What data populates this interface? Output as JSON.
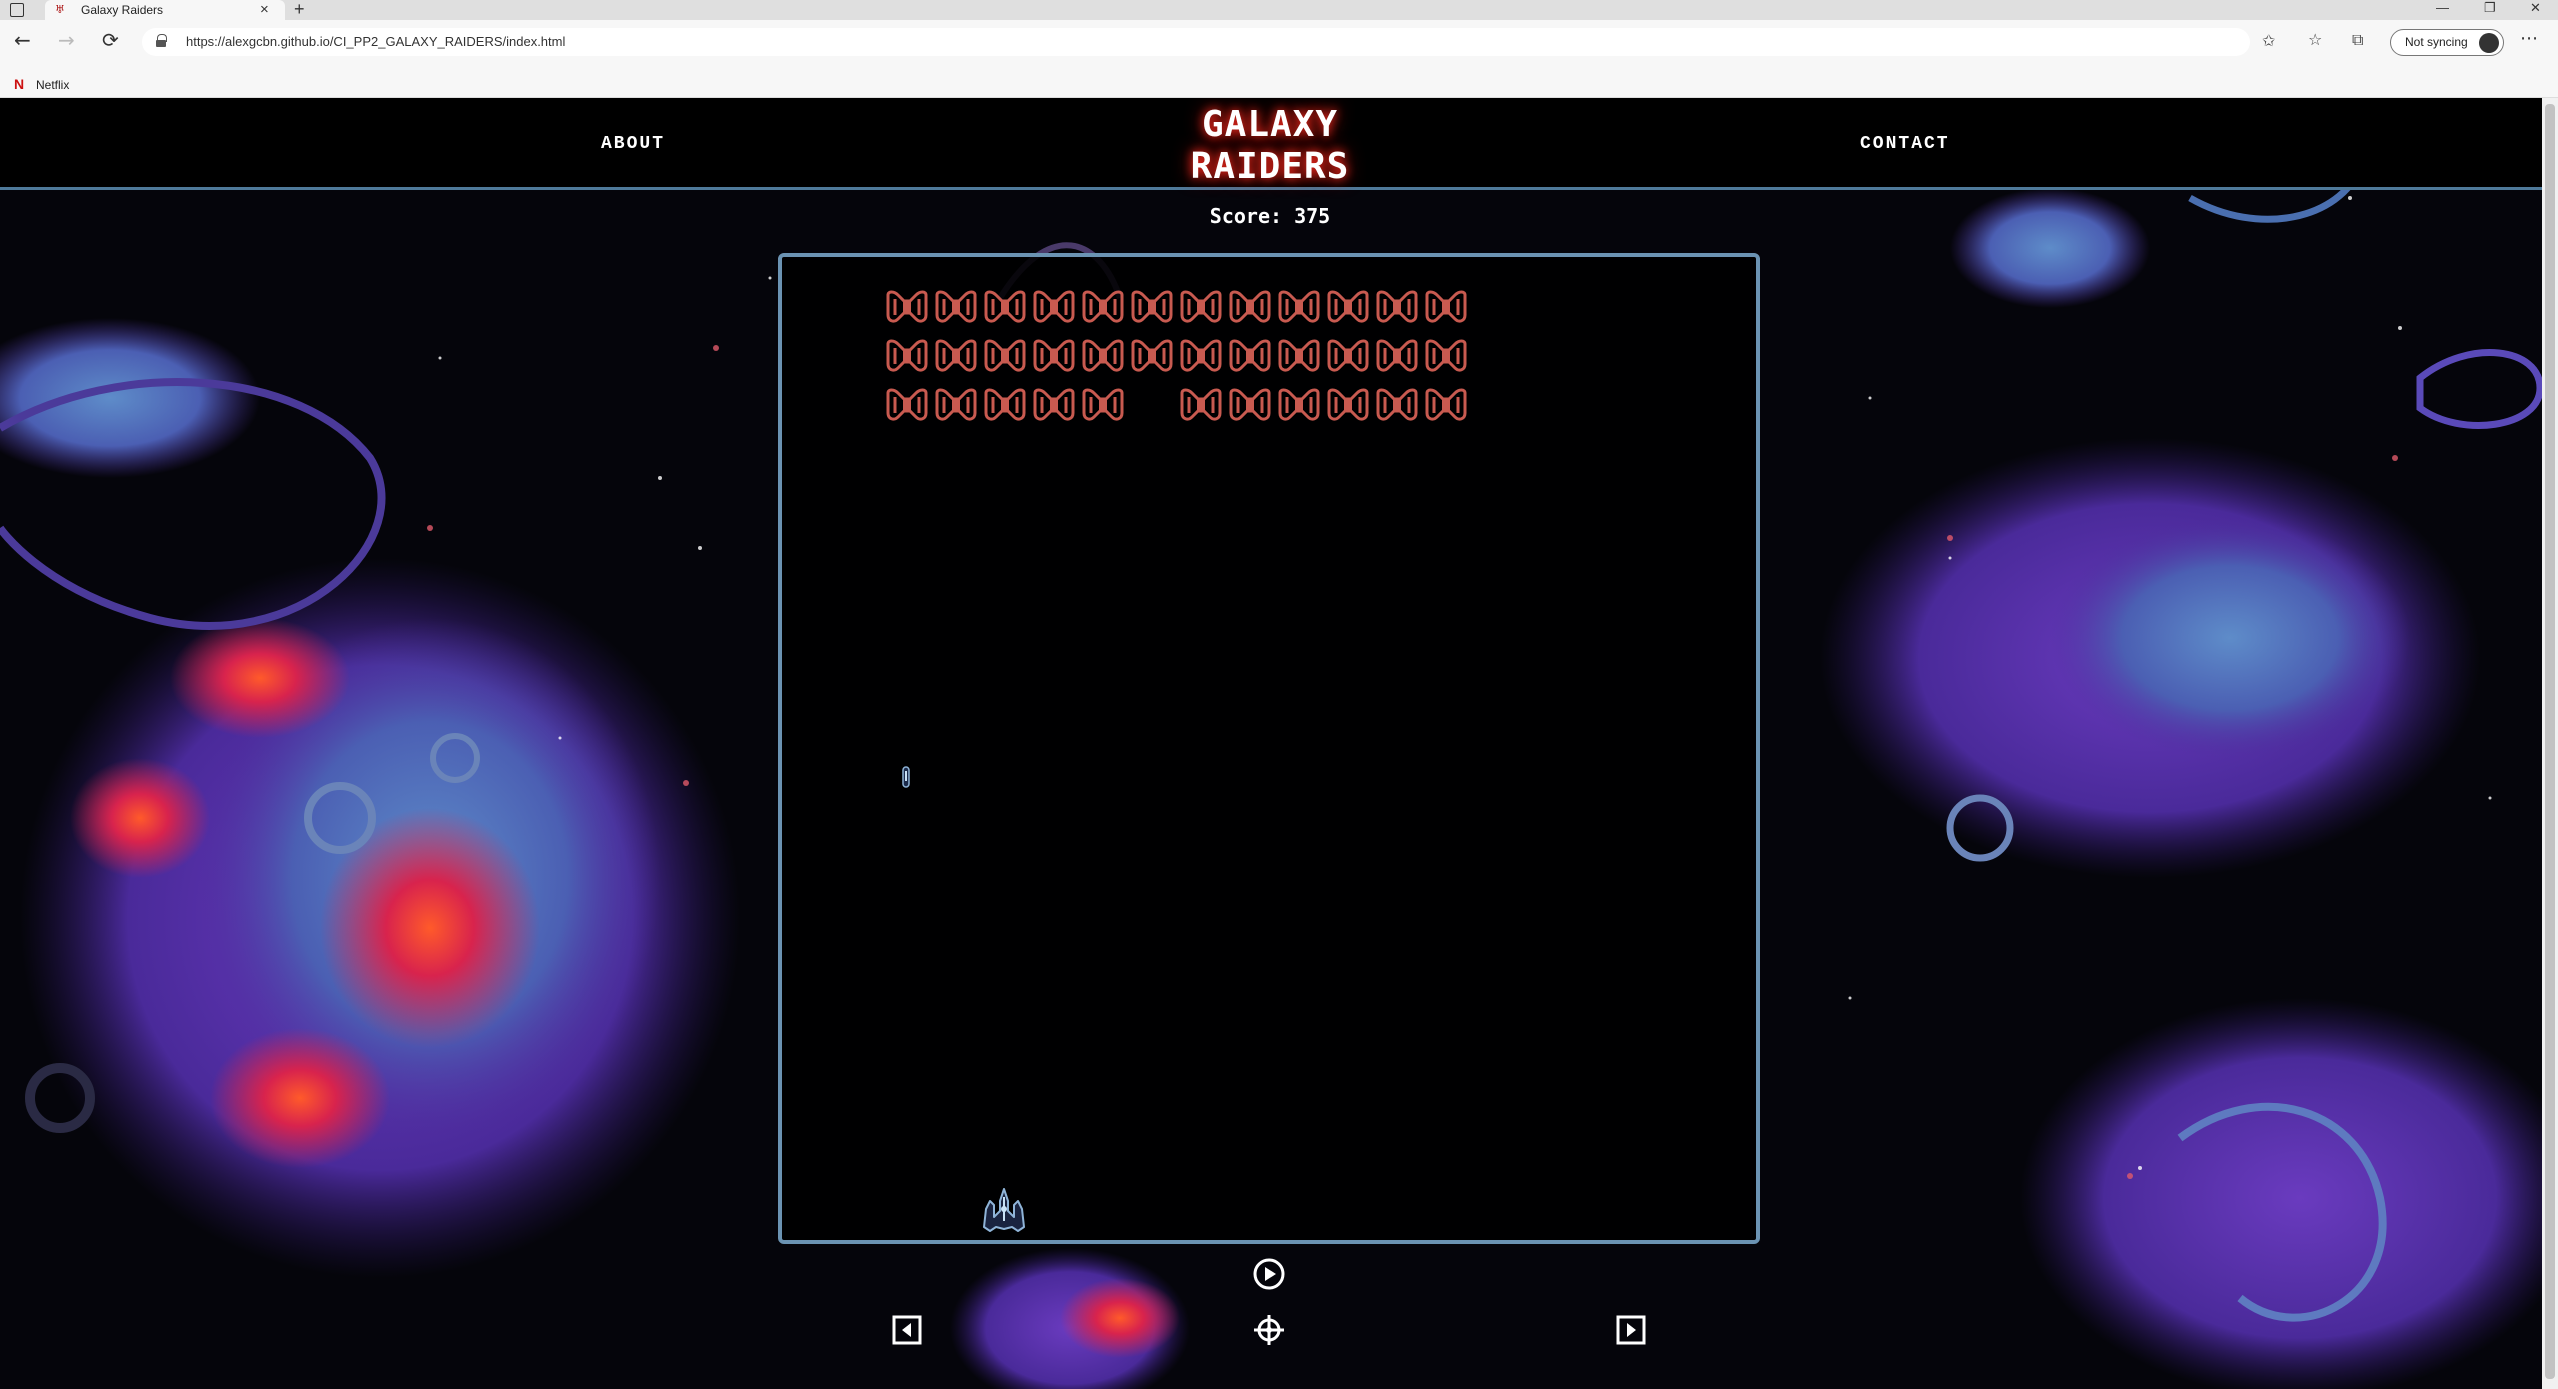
{
  "browser": {
    "tab_title": "Galaxy Raiders",
    "tab_close": "×",
    "new_tab": "+",
    "url": "https://alexgcbn.github.io/CI_PP2_GALAXY_RAIDERS/index.html",
    "profile_label": "Not syncing",
    "bookmark_label": "Netflix",
    "bookmark_icon": "N",
    "icons": {
      "back": "←",
      "forward": "→",
      "reload": "⟳",
      "minimize": "—",
      "maximize": "❐",
      "close": "✕",
      "more": "⋯",
      "favorites": "☆",
      "collections": "⧉",
      "add_favorite": "✩"
    }
  },
  "site": {
    "nav_about": "ABOUT",
    "nav_contact": "CONTACT",
    "logo_line1": "GALAXY",
    "logo_line2": "RAIDERS",
    "score_text": "Score: 375"
  },
  "game": {
    "alien_rows": [
      [
        1,
        1,
        1,
        1,
        1,
        1,
        1,
        1,
        1,
        1,
        1,
        1
      ],
      [
        1,
        1,
        1,
        1,
        1,
        1,
        1,
        1,
        1,
        1,
        1,
        1
      ],
      [
        1,
        1,
        1,
        1,
        1,
        0,
        1,
        1,
        1,
        1,
        1,
        1
      ]
    ],
    "alien_color": "#c85a50",
    "board_border_color": "#6b93b3",
    "player_ship_icon": "spaceship-icon",
    "missile_icon": "missile-icon"
  },
  "controls": {
    "play": "play-icon",
    "left": "arrow-left-icon",
    "fire": "crosshair-icon",
    "right": "arrow-right-icon"
  }
}
